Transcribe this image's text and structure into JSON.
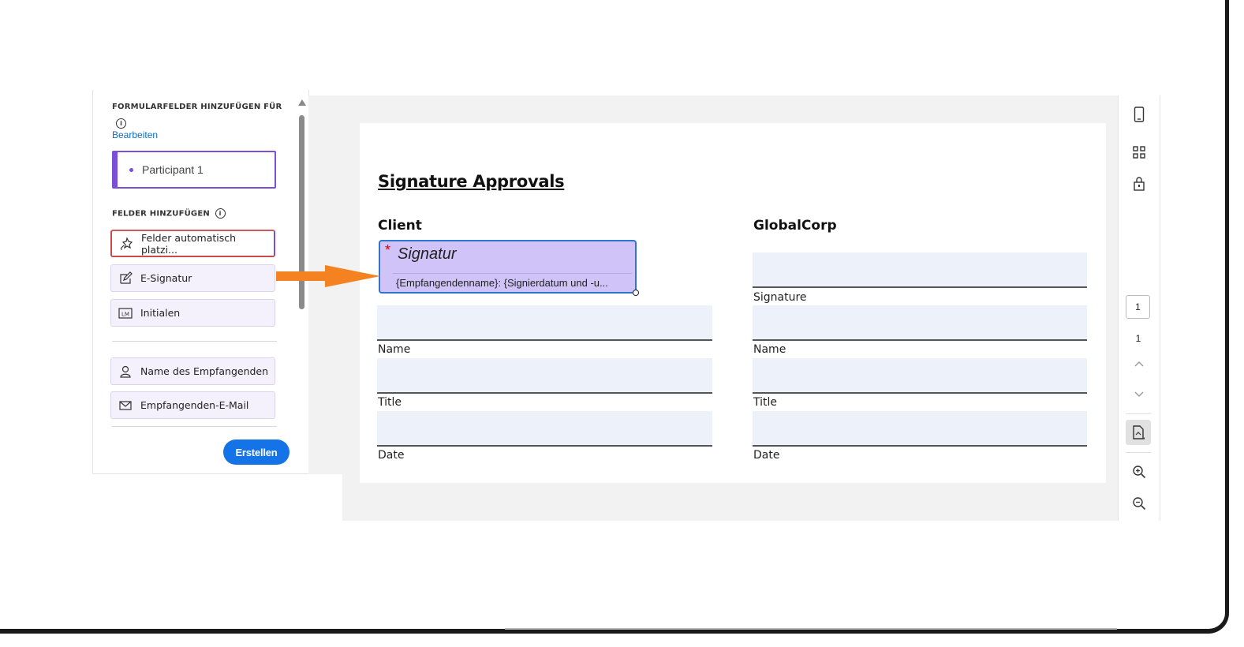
{
  "left_panel": {
    "form_fields_heading": "FORMULARFELDER HINZUFÜGEN FÜR",
    "edit_link": "Bearbeiten",
    "participant": "Participant 1",
    "add_fields_heading": "FELDER HINZUFÜGEN",
    "fields": {
      "auto_place": "Felder automatisch platzi...",
      "esignature": "E-Signatur",
      "initials": "Initialen",
      "recipient_name": "Name des Empfangenden",
      "recipient_email": "Empfangenden-E-Mail"
    },
    "create_button": "Erstellen"
  },
  "document": {
    "title": "Signature Approvals",
    "client_heading": "Client",
    "globalcorp_heading": "GlobalCorp",
    "signature_field": {
      "required_marker": "*",
      "title": "Signatur",
      "subtitle": "{Empfangendenname}: {Signierdatum und -u..."
    },
    "labels": {
      "signature": "Signature",
      "name": "Name",
      "title": "Title",
      "date": "Date"
    }
  },
  "right_toolbar": {
    "current_page": "1",
    "total_pages": "1"
  },
  "colors": {
    "accent_purple": "#7b4fd6",
    "primary_blue": "#1473e6",
    "arrow_orange": "#f58220",
    "signature_fill": "#cfc3f7"
  }
}
